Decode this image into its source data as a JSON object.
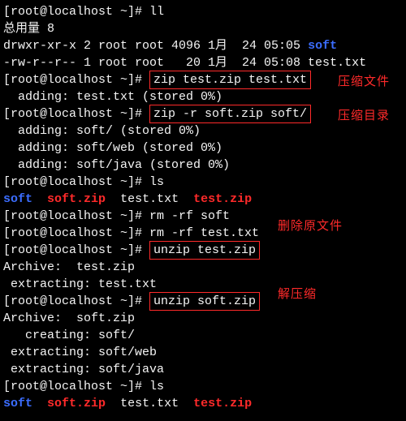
{
  "prompt": "[root@localhost ~]# ",
  "cmd": {
    "ll": "ll",
    "zip1": "zip test.zip test.txt",
    "zip2": "zip -r soft.zip soft/",
    "ls1": "ls",
    "rm1": "rm -rf soft",
    "rm2": "rm -rf test.txt",
    "unzip1": "unzip test.zip",
    "unzip2": "unzip soft.zip",
    "ls2": "ls"
  },
  "out": {
    "total": "总用量 8",
    "perm_dir": "drwxr-xr-x 2 root root 4096 1月  24 05:05 ",
    "soft": "soft",
    "perm_file": "-rw-r--r-- 1 root root   20 1月  24 05:08 test.txt",
    "add_test": "  adding: test.txt (stored 0%)",
    "add_softdir": "  adding: soft/ (stored 0%)",
    "add_softweb": "  adding: soft/web (stored 0%)",
    "add_softjava": "  adding: soft/java (stored 0%)",
    "archive_test": "Archive:  test.zip",
    "extract_test": " extracting: test.txt",
    "archive_soft": "Archive:  soft.zip",
    "create_soft": "   creating: soft/",
    "extract_web": " extracting: soft/web",
    "extract_java": " extracting: soft/java"
  },
  "ls": {
    "soft": "soft",
    "sep1": "  ",
    "softzip": "soft.zip",
    "sep2": "  ",
    "testtxt": "test.txt",
    "sep3": "  ",
    "testzip": "test.zip"
  },
  "notes": {
    "zip_file": "压缩文件",
    "zip_dir": "压缩目录",
    "del_orig": "删除原文件",
    "unzip": "解压缩"
  }
}
